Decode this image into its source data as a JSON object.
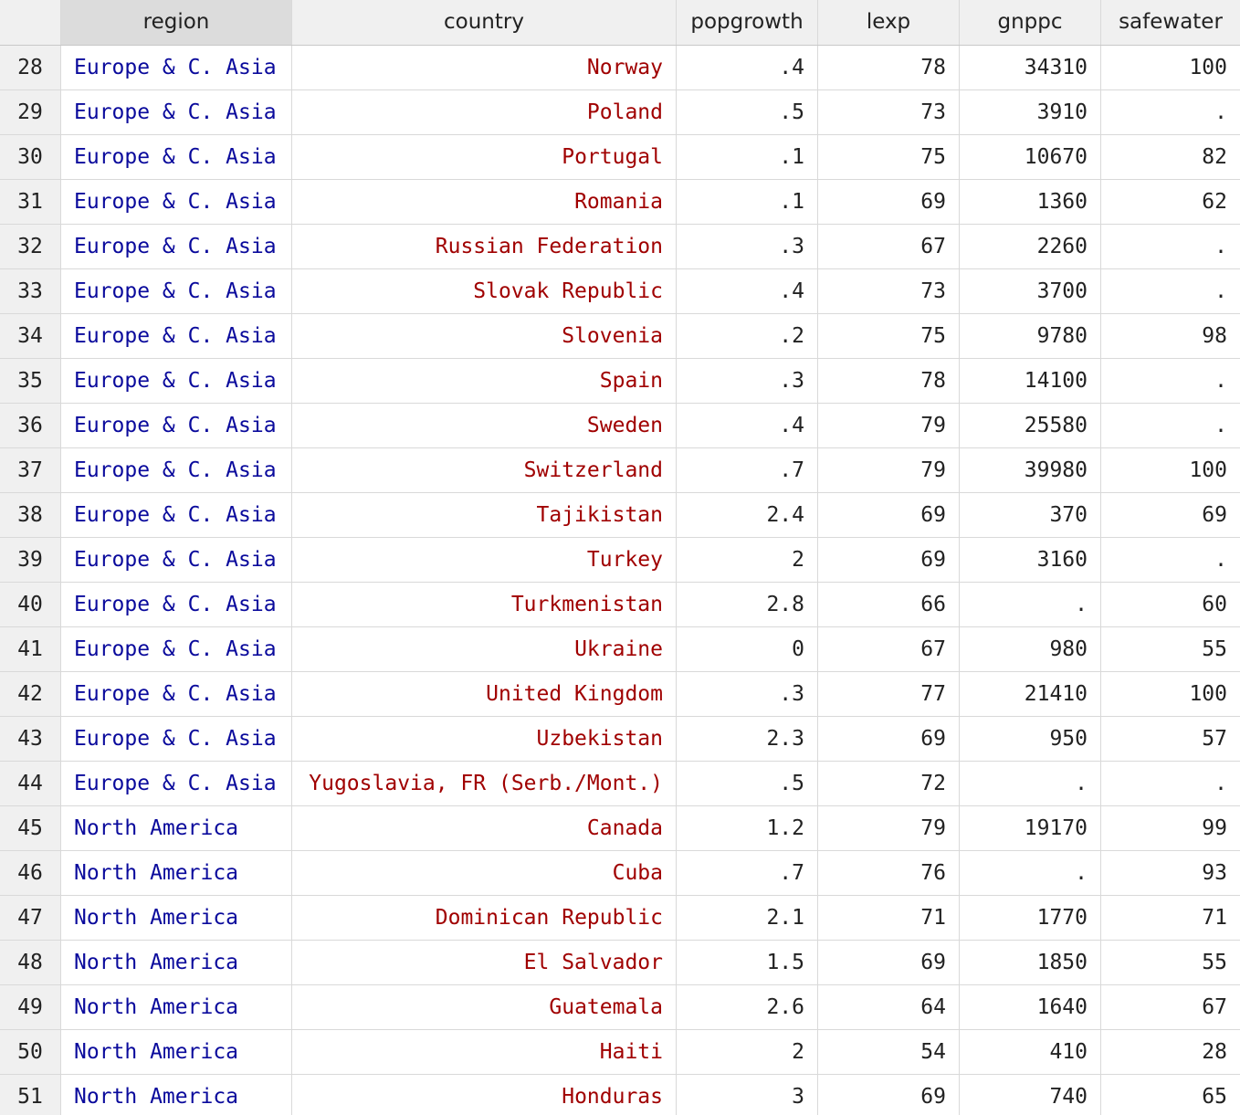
{
  "table": {
    "columns": [
      "region",
      "country",
      "popgrowth",
      "lexp",
      "gnppc",
      "safewater"
    ],
    "rows": [
      {
        "idx": "28",
        "region": "Europe & C. Asia",
        "country": "Norway",
        "popgrowth": ".4",
        "lexp": "78",
        "gnppc": "34310",
        "safewater": "100"
      },
      {
        "idx": "29",
        "region": "Europe & C. Asia",
        "country": "Poland",
        "popgrowth": ".5",
        "lexp": "73",
        "gnppc": "3910",
        "safewater": "."
      },
      {
        "idx": "30",
        "region": "Europe & C. Asia",
        "country": "Portugal",
        "popgrowth": ".1",
        "lexp": "75",
        "gnppc": "10670",
        "safewater": "82"
      },
      {
        "idx": "31",
        "region": "Europe & C. Asia",
        "country": "Romania",
        "popgrowth": ".1",
        "lexp": "69",
        "gnppc": "1360",
        "safewater": "62"
      },
      {
        "idx": "32",
        "region": "Europe & C. Asia",
        "country": "Russian Federation",
        "popgrowth": ".3",
        "lexp": "67",
        "gnppc": "2260",
        "safewater": "."
      },
      {
        "idx": "33",
        "region": "Europe & C. Asia",
        "country": "Slovak Republic",
        "popgrowth": ".4",
        "lexp": "73",
        "gnppc": "3700",
        "safewater": "."
      },
      {
        "idx": "34",
        "region": "Europe & C. Asia",
        "country": "Slovenia",
        "popgrowth": ".2",
        "lexp": "75",
        "gnppc": "9780",
        "safewater": "98"
      },
      {
        "idx": "35",
        "region": "Europe & C. Asia",
        "country": "Spain",
        "popgrowth": ".3",
        "lexp": "78",
        "gnppc": "14100",
        "safewater": "."
      },
      {
        "idx": "36",
        "region": "Europe & C. Asia",
        "country": "Sweden",
        "popgrowth": ".4",
        "lexp": "79",
        "gnppc": "25580",
        "safewater": "."
      },
      {
        "idx": "37",
        "region": "Europe & C. Asia",
        "country": "Switzerland",
        "popgrowth": ".7",
        "lexp": "79",
        "gnppc": "39980",
        "safewater": "100"
      },
      {
        "idx": "38",
        "region": "Europe & C. Asia",
        "country": "Tajikistan",
        "popgrowth": "2.4",
        "lexp": "69",
        "gnppc": "370",
        "safewater": "69"
      },
      {
        "idx": "39",
        "region": "Europe & C. Asia",
        "country": "Turkey",
        "popgrowth": "2",
        "lexp": "69",
        "gnppc": "3160",
        "safewater": "."
      },
      {
        "idx": "40",
        "region": "Europe & C. Asia",
        "country": "Turkmenistan",
        "popgrowth": "2.8",
        "lexp": "66",
        "gnppc": ".",
        "safewater": "60"
      },
      {
        "idx": "41",
        "region": "Europe & C. Asia",
        "country": "Ukraine",
        "popgrowth": "0",
        "lexp": "67",
        "gnppc": "980",
        "safewater": "55"
      },
      {
        "idx": "42",
        "region": "Europe & C. Asia",
        "country": "United Kingdom",
        "popgrowth": ".3",
        "lexp": "77",
        "gnppc": "21410",
        "safewater": "100"
      },
      {
        "idx": "43",
        "region": "Europe & C. Asia",
        "country": "Uzbekistan",
        "popgrowth": "2.3",
        "lexp": "69",
        "gnppc": "950",
        "safewater": "57"
      },
      {
        "idx": "44",
        "region": "Europe & C. Asia",
        "country": "Yugoslavia, FR (Serb./Mont.)",
        "popgrowth": ".5",
        "lexp": "72",
        "gnppc": ".",
        "safewater": "."
      },
      {
        "idx": "45",
        "region": "North America",
        "country": "Canada",
        "popgrowth": "1.2",
        "lexp": "79",
        "gnppc": "19170",
        "safewater": "99"
      },
      {
        "idx": "46",
        "region": "North America",
        "country": "Cuba",
        "popgrowth": ".7",
        "lexp": "76",
        "gnppc": ".",
        "safewater": "93"
      },
      {
        "idx": "47",
        "region": "North America",
        "country": "Dominican Republic",
        "popgrowth": "2.1",
        "lexp": "71",
        "gnppc": "1770",
        "safewater": "71"
      },
      {
        "idx": "48",
        "region": "North America",
        "country": "El Salvador",
        "popgrowth": "1.5",
        "lexp": "69",
        "gnppc": "1850",
        "safewater": "55"
      },
      {
        "idx": "49",
        "region": "North America",
        "country": "Guatemala",
        "popgrowth": "2.6",
        "lexp": "64",
        "gnppc": "1640",
        "safewater": "67"
      },
      {
        "idx": "50",
        "region": "North America",
        "country": "Haiti",
        "popgrowth": "2",
        "lexp": "54",
        "gnppc": "410",
        "safewater": "28"
      },
      {
        "idx": "51",
        "region": "North America",
        "country": "Honduras",
        "popgrowth": "3",
        "lexp": "69",
        "gnppc": "740",
        "safewater": "65"
      }
    ]
  },
  "colors": {
    "region_text": "#0a0a9c",
    "country_text": "#a00000",
    "header_bg": "#f0f0f0",
    "selected_header_bg": "#dcdcdc"
  }
}
